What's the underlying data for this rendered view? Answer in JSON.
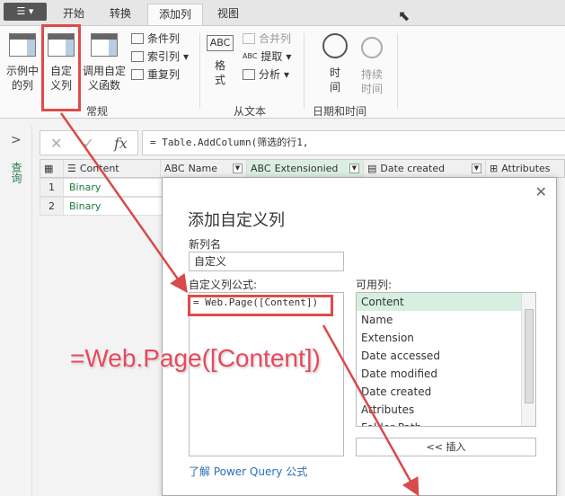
{
  "ribbon_tabs": [
    "开始",
    "转换",
    "添加列",
    "视图"
  ],
  "active_tab": "添加列",
  "ribbon": {
    "example_col": "示例中\n的列",
    "custom_col": "自定\n义列",
    "invoke_fn": "调用自定\n义函数",
    "conditional_col": "条件列",
    "index_col": "索引列",
    "duplicate_col": "重复列",
    "group_general": "常规",
    "format": "格\n式",
    "merge_cols": "合并列",
    "extract": "提取",
    "parse": "分析",
    "group_text": "从文本",
    "time": "时\n间",
    "duration": "持续\n时间",
    "group_datetime": "日期和时间"
  },
  "side": {
    "label": "查询",
    "expand": ">"
  },
  "formula_bar": {
    "cancel": "✕",
    "confirm": "✓",
    "fx": "fx",
    "value": "= Table.AddColumn(筛选的行1,"
  },
  "table": {
    "columns": [
      "Content",
      "Name",
      "Extensionied",
      "Date created",
      "Attributes"
    ],
    "rows": [
      {
        "n": "1",
        "v": "Binary"
      },
      {
        "n": "2",
        "v": "Binary"
      }
    ]
  },
  "dialog": {
    "title": "添加自定义列",
    "close": "✕",
    "new_name_label": "新列名",
    "new_name_value": "自定义",
    "formula_label": "自定义列公式:",
    "formula_value": "= Web.Page([Content])",
    "available_label": "可用列:",
    "available": [
      "Content",
      "Name",
      "Extension",
      "Date accessed",
      "Date modified",
      "Date created",
      "Attributes",
      "Folder Path"
    ],
    "insert_button": "<< 插入",
    "learn_link": "了解 Power Query 公式"
  },
  "annotation": "=Web.Page([Content])",
  "colors": {
    "highlight": "#e04a4a",
    "annotation": "#e8485a",
    "selected": "#d6efe0"
  }
}
